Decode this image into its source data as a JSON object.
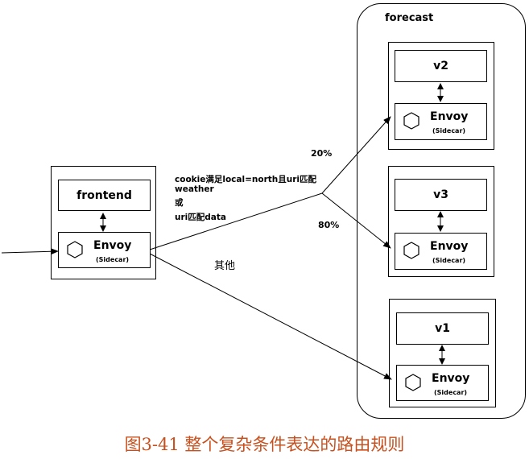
{
  "frontend": {
    "service": "frontend",
    "envoy": "Envoy",
    "sidecar": "(Sidecar)"
  },
  "forecast": {
    "title": "forecast",
    "v2": {
      "service": "v2",
      "envoy": "Envoy",
      "sidecar": "(Sidecar)"
    },
    "v3": {
      "service": "v3",
      "envoy": "Envoy",
      "sidecar": "(Sidecar)"
    },
    "v1": {
      "service": "v1",
      "envoy": "Envoy",
      "sidecar": "(Sidecar)"
    }
  },
  "rule": {
    "line1": "cookie满足local=north且uri匹配",
    "line2": "weather",
    "line3": "或",
    "line4": "uri匹配data"
  },
  "split": {
    "v2_percent": "20%",
    "v3_percent": "80%"
  },
  "other_label": "其他",
  "caption": "图3-41 整个复杂条件表达的路由规则",
  "colors": {
    "caption": "#c8501e",
    "stroke": "#000000"
  }
}
